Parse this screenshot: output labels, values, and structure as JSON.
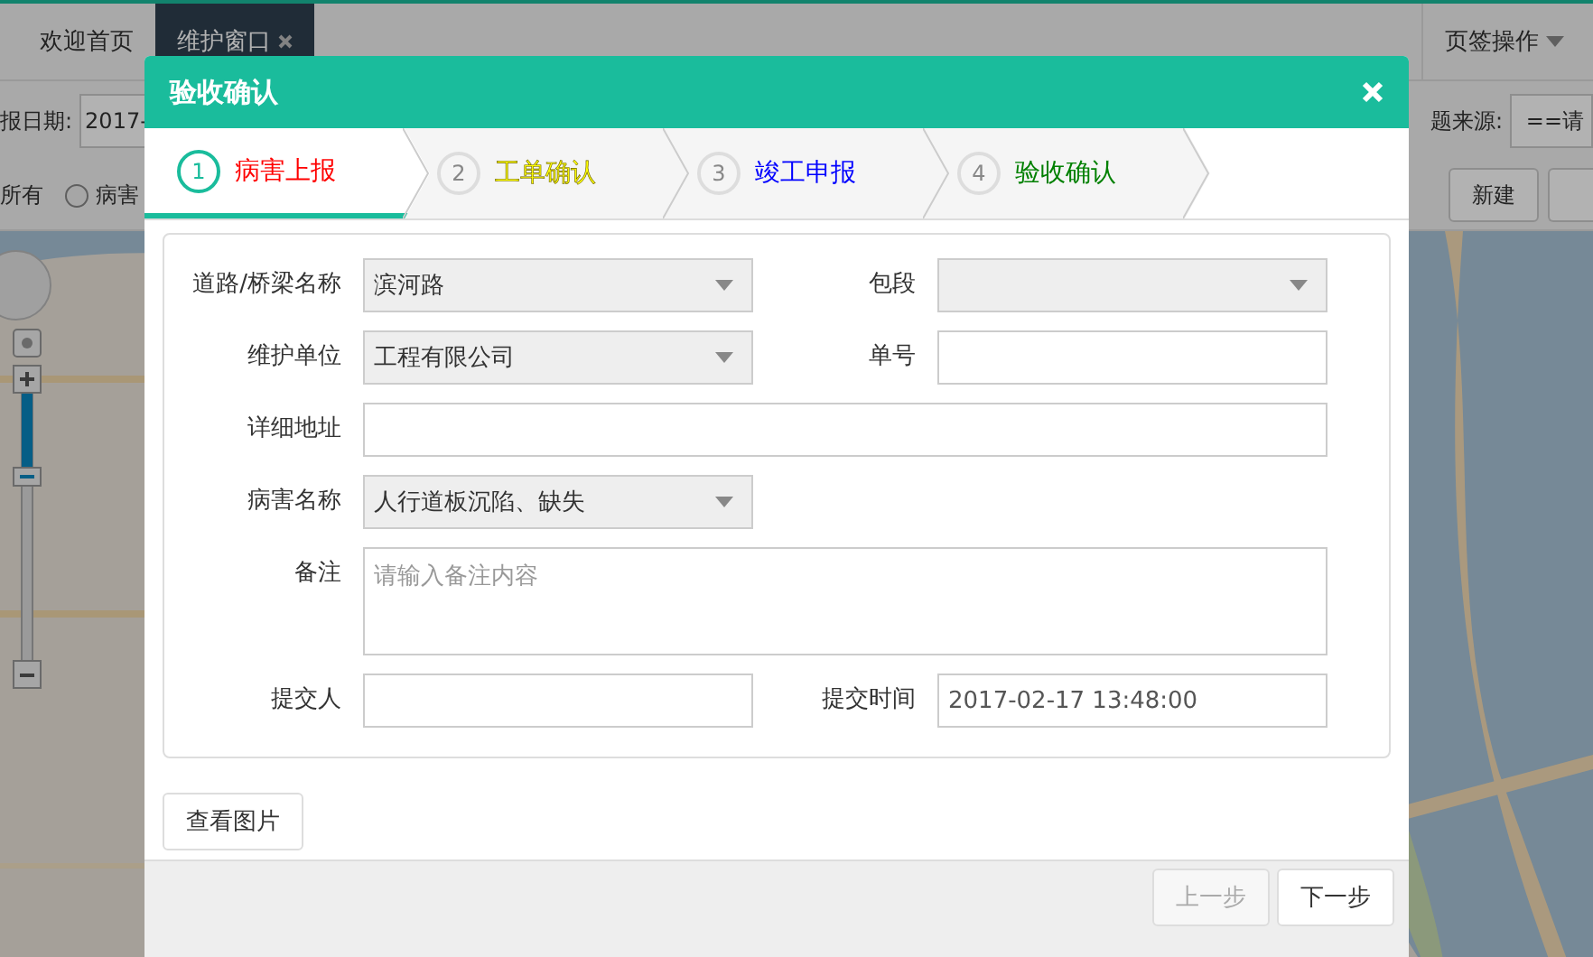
{
  "tabs": [
    {
      "label": "欢迎首页",
      "selected": false,
      "closable": false
    },
    {
      "label": "维护窗口",
      "selected": true,
      "closable": true
    }
  ],
  "tab_actions": {
    "label": "页签操作"
  },
  "filter": {
    "date_label": "报日期:",
    "date_value": "2017-",
    "all_label": "所有",
    "radio": {
      "label": "病害",
      "selected": false
    },
    "source_label": "题来源:",
    "source_value": "==请",
    "button": "新建"
  },
  "dialog": {
    "title": "验收确认",
    "steps": [
      {
        "number": "1",
        "label": "病害上报",
        "color": "#ff0000",
        "selected": true
      },
      {
        "number": "2",
        "label": "工单确认",
        "color": "#ffff00",
        "selected": false
      },
      {
        "number": "3",
        "label": "竣工申报",
        "color": "#0000ff",
        "selected": false
      },
      {
        "number": "4",
        "label": "验收确认",
        "color": "#008000",
        "selected": false
      }
    ],
    "form": [
      [
        {
          "label": "道路/桥梁名称",
          "kind": "select",
          "value": "滨河路"
        },
        {
          "label": "包段",
          "kind": "select"
        }
      ],
      [
        {
          "label": "维护单位",
          "kind": "select",
          "value": "工程有限公司"
        },
        {
          "label": "单号",
          "kind": "input"
        }
      ],
      [
        {
          "label": "详细地址",
          "kind": "long_input"
        }
      ],
      [
        {
          "label": "病害名称",
          "kind": "select",
          "value": "人行道板沉陷、缺失"
        }
      ],
      [
        {
          "label": "备注",
          "kind": "textarea",
          "placeholder": "请输入备注内容"
        }
      ],
      [
        {
          "label": "提交人",
          "kind": "input"
        },
        {
          "label": "提交时间",
          "kind": "input",
          "value": "2017-02-17 13:48:00"
        }
      ]
    ],
    "view_button": "查看图片",
    "footer_buttons": [
      {
        "label": "上一步",
        "disabled": true
      },
      {
        "label": "下一步",
        "disabled": false
      }
    ]
  }
}
